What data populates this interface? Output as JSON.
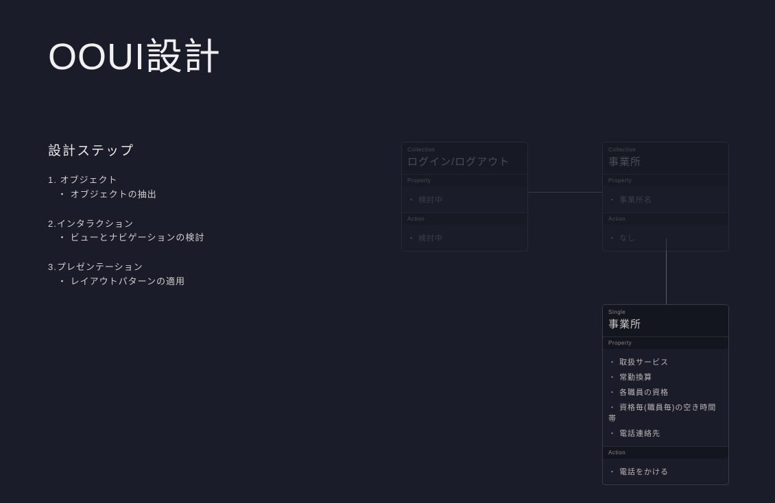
{
  "pageTitle": "OOUI設計",
  "sectionHeading": "設計ステップ",
  "steps": [
    {
      "label": "1. オブジェクト",
      "sub": "・ オブジェクトの抽出"
    },
    {
      "label": "2.インタラクション",
      "sub": "・ ビューとナビゲーションの検討"
    },
    {
      "label": "3.プレゼンテーション",
      "sub": "・ レイアウトパターンの適用"
    }
  ],
  "cards": {
    "login": {
      "type": "Collection",
      "title": "ログイン/ログアウト",
      "propertyLabel": "Property",
      "properties": [
        "検討中"
      ],
      "actionLabel": "Action",
      "actions": [
        "検討中"
      ]
    },
    "officeCollection": {
      "type": "Collection",
      "title": "事業所",
      "propertyLabel": "Property",
      "properties": [
        "事業所名"
      ],
      "actionLabel": "Action",
      "actions": [
        "なし"
      ]
    },
    "officeSingle": {
      "type": "Single",
      "title": "事業所",
      "propertyLabel": "Property",
      "properties": [
        "取扱サービス",
        "常勤換算",
        "各職員の資格",
        "資格毎(職員毎)の空き時間帯",
        "電話連絡先"
      ],
      "actionLabel": "Action",
      "actions": [
        "電話をかける"
      ]
    }
  }
}
